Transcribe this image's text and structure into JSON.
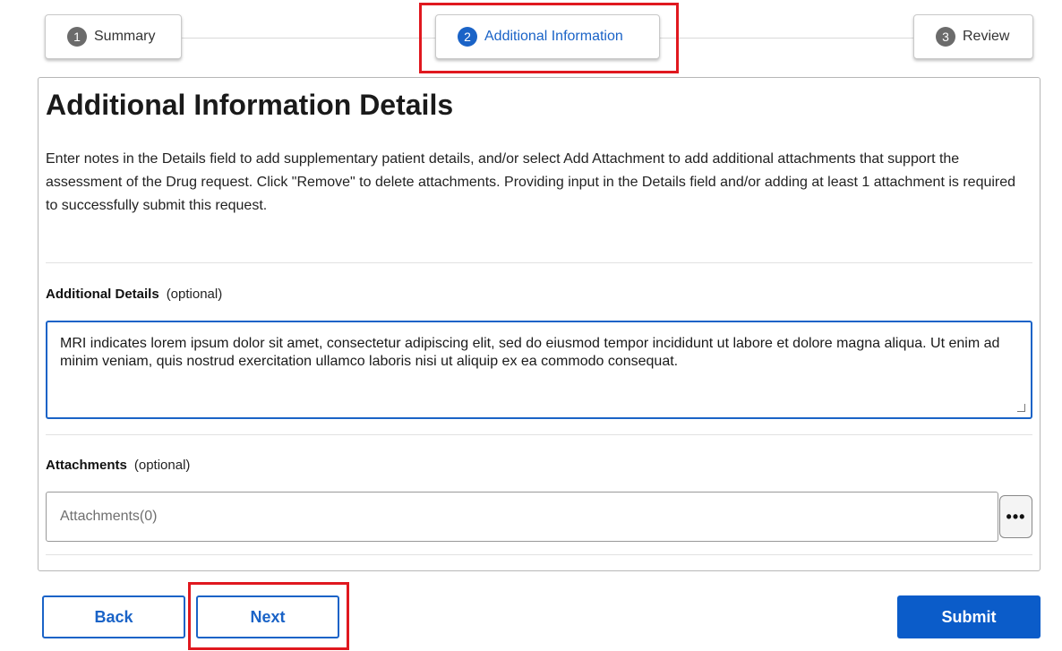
{
  "stepper": {
    "steps": [
      {
        "number": "1",
        "label": "Summary"
      },
      {
        "number": "2",
        "label": "Additional Information"
      },
      {
        "number": "3",
        "label": "Review"
      }
    ],
    "active_step": 2
  },
  "main": {
    "title": "Additional Information Details",
    "description": "Enter notes in the Details field to add supplementary patient details, and/or select Add Attachment to add additional attachments that support the assessment of the Drug request. Click \"Remove\" to delete attachments. Providing input in the Details field and/or adding at least 1 attachment is required to successfully submit this request.",
    "details": {
      "label": "Additional Details",
      "optional": "(optional)",
      "value": "MRI indicates lorem ipsum dolor sit amet, consectetur adipiscing elit, sed do eiusmod tempor incididunt ut labore et dolore magna aliqua. Ut enim ad minim veniam, quis nostrud exercitation ullamco laboris nisi ut aliquip ex ea commodo consequat."
    },
    "attachments": {
      "label": "Attachments",
      "optional": "(optional)",
      "placeholder": "Attachments(0)",
      "more_icon": "ellipsis-icon",
      "more_label": "•••"
    }
  },
  "footer": {
    "back_label": "Back",
    "next_label": "Next",
    "submit_label": "Submit"
  },
  "colors": {
    "accent": "#1a63c7",
    "primary_button": "#0b5cc9",
    "highlight": "#e0181f"
  }
}
